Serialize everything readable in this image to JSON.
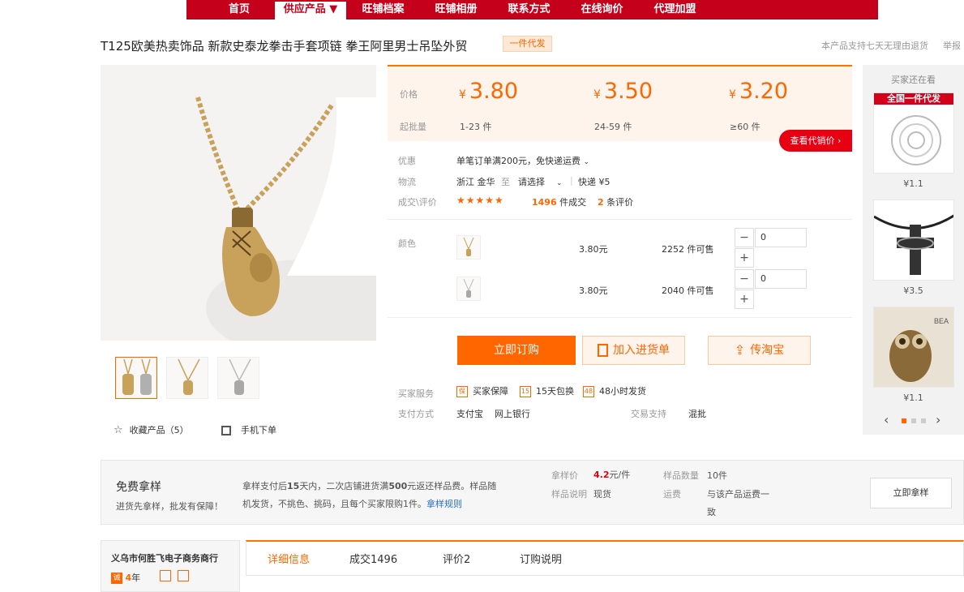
{
  "nav": {
    "items": [
      "首页",
      "供应产品 ▼",
      "旺铺档案",
      "旺铺相册",
      "联系方式",
      "在线询价",
      "代理加盟"
    ],
    "active_index": 1
  },
  "product": {
    "title": "T125欧美热卖饰品 新款史泰龙拳击手套项链 拳王阿里男士吊坠外贸",
    "tag": "一件代发",
    "return_policy": "本产品支持七天无理由退货",
    "report": "举报"
  },
  "pricing": {
    "price_label": "价格",
    "qty_label": "起批量",
    "currency": "¥",
    "tiers": [
      {
        "price": "3.80",
        "qty": "1-23 件"
      },
      {
        "price": "3.50",
        "qty": "24-59 件"
      },
      {
        "price": "3.20",
        "qty": "≥60 件"
      }
    ],
    "agent_price_button": "查看代销价 ›"
  },
  "info": {
    "discount_label": "优惠",
    "discount_text": "单笔订单满200元，免快递运费",
    "logistics_label": "物流",
    "origin": "浙江 金华",
    "to": "至",
    "destination": "请选择",
    "express": "快递 ¥5",
    "deal_label": "成交\\评价",
    "stars": "★★★★★",
    "deals_count": "1496",
    "deals_suffix": "件成交",
    "reviews_count": "2",
    "reviews_suffix": "条评价"
  },
  "sku": {
    "color_label": "颜色",
    "rows": [
      {
        "price": "3.80元",
        "stock": "2252 件可售",
        "qty": "0"
      },
      {
        "price": "3.80元",
        "stock": "2040 件可售",
        "qty": "0"
      }
    ],
    "minus": "−",
    "plus": "+"
  },
  "actions": {
    "buy_now": "立即订购",
    "add_to_list": "加入进货单",
    "taobao": "传淘宝"
  },
  "service": {
    "service_label": "买家服务",
    "items": [
      {
        "icon": "保",
        "text": "买家保障"
      },
      {
        "icon": "15",
        "text": "15天包换"
      },
      {
        "icon": "48",
        "text": "48小时发货"
      }
    ],
    "payment_label": "支付方式",
    "payment_methods": "支付宝    网上银行",
    "trade_label": "交易支持",
    "trade_value": "混批"
  },
  "gallery": {
    "favorite": "收藏产品（5）",
    "mobile_order": "手机下单"
  },
  "recommend": {
    "title": "买家还在看",
    "banner": "全国一件代发",
    "items": [
      {
        "price": "¥1.1"
      },
      {
        "price": "¥3.5"
      },
      {
        "price": "¥1.1"
      }
    ],
    "owl_text": "BEA"
  },
  "sample": {
    "title": "免费拿样",
    "subtitle": "进货先拿样，批发有保障！",
    "desc_line1_a": "拿样支付后",
    "desc_line1_b": "15",
    "desc_line1_c": "天内，二次店铺进货满",
    "desc_line1_d": "500",
    "desc_line1_e": "元返还样品费。样品随",
    "desc_line2": "机发货，不挑色、挑码，且每个买家限购1件。",
    "desc_link": "拿样规则",
    "price_label": "拿样价",
    "price_value": "4.2",
    "price_unit": "元/件",
    "count_label": "样品数量",
    "count_value": "10件",
    "note_label": "样品说明",
    "note_value": "现货",
    "freight_label": "运费",
    "freight_line1": "与该产品运费一",
    "freight_line2": "致",
    "button": "立即拿样"
  },
  "shop": {
    "name": "义乌市何胜飞电子商务商行",
    "years_badge": "诚",
    "years": "4",
    "years_unit": "年"
  },
  "tabs": [
    "详细信息",
    "成交1496",
    "评价2",
    "订购说明"
  ],
  "colors": {
    "accent": "#ff6600",
    "nav": "#c4001b",
    "red": "#e60012"
  }
}
